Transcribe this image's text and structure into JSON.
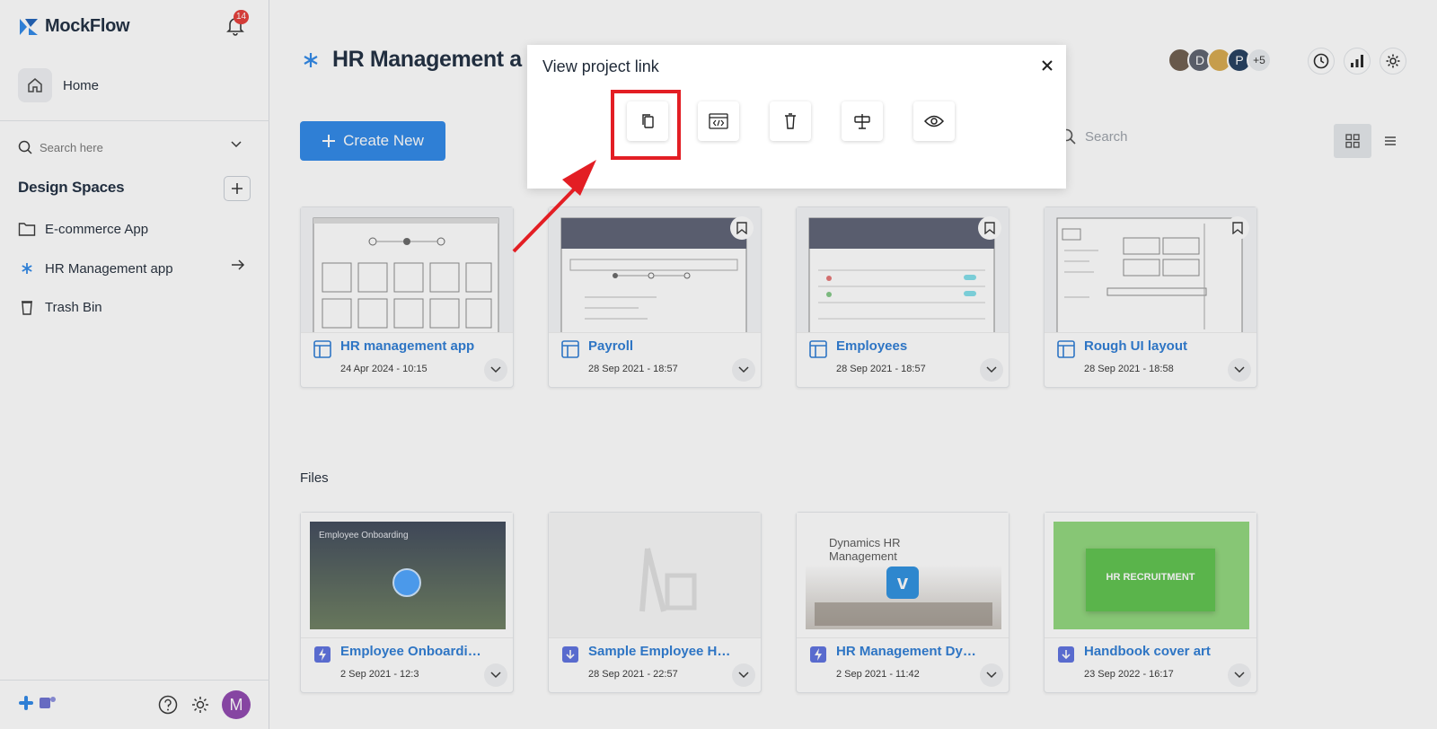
{
  "brand": {
    "name": "MockFlow"
  },
  "notifications": {
    "count": "14"
  },
  "sidebar": {
    "home_label": "Home",
    "search_placeholder": "Search here",
    "section_title": "Design Spaces",
    "items": [
      {
        "label": "E-commerce App",
        "icon": "folder-icon"
      },
      {
        "label": "HR Management app",
        "icon": "asterisk-icon"
      },
      {
        "label": "Trash Bin",
        "icon": "trash-icon"
      }
    ],
    "avatar_initial": "M"
  },
  "header": {
    "title": "HR Management a",
    "collaborators": [
      "",
      "D",
      "",
      "P"
    ],
    "more_collaborators": "+5"
  },
  "toolbar": {
    "create_label": "Create New",
    "search_placeholder": "Search"
  },
  "projects": [
    {
      "title": "HR management app",
      "date": "24 Apr 2024 - 10:15"
    },
    {
      "title": "Payroll",
      "date": "28 Sep 2021 - 18:57"
    },
    {
      "title": "Employees",
      "date": "28 Sep 2021 - 18:57"
    },
    {
      "title": "Rough UI layout",
      "date": "28 Sep 2021 - 18:58"
    }
  ],
  "files_section": {
    "label": "Files",
    "items": [
      {
        "title": "Employee Onboarding",
        "date": "2 Sep 2021 - 12:3",
        "thumb_text": "Employee Onboarding"
      },
      {
        "title": "Sample Employee Hand...",
        "date": "28 Sep 2021 - 22:57",
        "thumb_text": ""
      },
      {
        "title": "HR Management Dyna...",
        "date": "2 Sep 2021 - 11:42",
        "thumb_text": "Dynamics HR Management"
      },
      {
        "title": "Handbook cover art",
        "date": "23 Sep 2022 - 16:17",
        "thumb_text": "HR RECRUITMENT"
      }
    ]
  },
  "modal": {
    "title": "View project link",
    "close": "×",
    "actions": [
      "copy-icon",
      "embed-code-icon",
      "delete-icon",
      "sign-icon",
      "preview-icon"
    ]
  },
  "colors": {
    "accent": "#2b86e8",
    "highlight": "#e31e24",
    "badge": "#e53935"
  }
}
